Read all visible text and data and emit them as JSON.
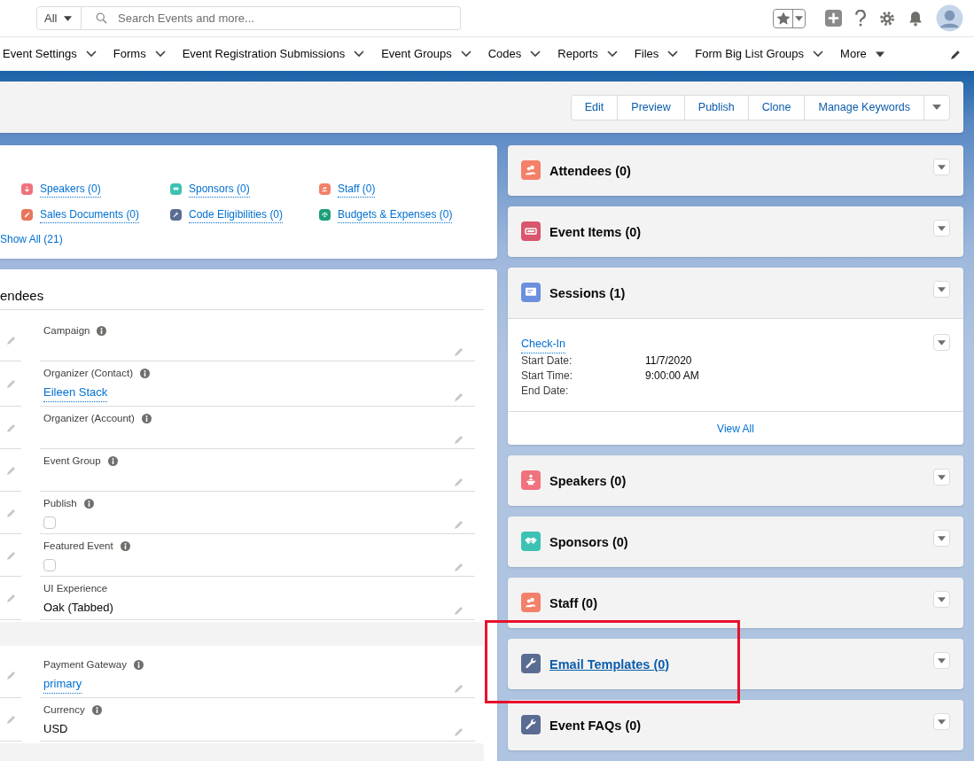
{
  "global_header": {
    "scope": "All",
    "search_placeholder": "Search Events and more..."
  },
  "nav": {
    "items": [
      {
        "label": "Event Settings",
        "kind": "menu"
      },
      {
        "label": "Forms",
        "kind": "menu"
      },
      {
        "label": "Event Registration Submissions",
        "kind": "menu"
      },
      {
        "label": "Event Groups",
        "kind": "menu"
      },
      {
        "label": "Codes",
        "kind": "menu"
      },
      {
        "label": "Reports",
        "kind": "menu"
      },
      {
        "label": "Files",
        "kind": "menu"
      },
      {
        "label": "Form Big List Groups",
        "kind": "menu"
      },
      {
        "label": "More",
        "kind": "more"
      }
    ]
  },
  "highlights": {
    "buttons": [
      "Edit",
      "Preview",
      "Publish",
      "Clone",
      "Manage Keywords"
    ]
  },
  "related_links": {
    "items": [
      {
        "label": "Speakers (0)",
        "kind": "podium",
        "color": "#f0727e"
      },
      {
        "label": "Sponsors (0)",
        "kind": "handshake",
        "color": "#3cc2b3"
      },
      {
        "label": "Staff (0)",
        "kind": "people",
        "color": "#f4806a"
      },
      {
        "label": "Sales Documents (0)",
        "kind": "pencil",
        "color": "#e9765a"
      },
      {
        "label": "Code Eligibilities (0)",
        "kind": "wrench",
        "color": "#5a6c92"
      },
      {
        "label": "Budgets & Expenses (0)",
        "kind": "scale",
        "color": "#1b9e7a"
      }
    ],
    "show_all": "Show All (21)"
  },
  "details": {
    "title": "endees",
    "blocks": [
      {
        "kind": "fields",
        "fields": [
          {
            "label": "Campaign",
            "info": true,
            "kind": "text"
          },
          {
            "label": "Organizer (Contact)",
            "info": true,
            "kind": "link",
            "value": "Eileen Stack"
          },
          {
            "label": "Organizer (Account)",
            "info": true,
            "kind": "text"
          },
          {
            "label": "Event Group",
            "info": true,
            "kind": "text"
          },
          {
            "label": "Publish",
            "info": true,
            "kind": "checkbox",
            "checked": false
          },
          {
            "label": "Featured Event",
            "info": true,
            "kind": "checkbox",
            "checked": false
          },
          {
            "label": "UI Experience",
            "info": false,
            "kind": "text",
            "value": "Oak (Tabbed)"
          }
        ]
      },
      {
        "kind": "section-bar"
      },
      {
        "kind": "fields",
        "fields": [
          {
            "label": "Payment Gateway",
            "info": true,
            "kind": "link",
            "value": "primary"
          },
          {
            "label": "Currency",
            "info": true,
            "kind": "text",
            "value": "USD"
          }
        ]
      },
      {
        "kind": "section-bar"
      }
    ]
  },
  "related_lists": [
    {
      "title": "Attendees (0)",
      "kind": "people",
      "color": "#f4806a",
      "hovered": false
    },
    {
      "title": "Event Items (0)",
      "kind": "ticket",
      "color": "#d9566d",
      "hovered": false
    },
    {
      "title": "Sessions (1)",
      "kind": "screen",
      "color": "#6b8fde",
      "hovered": false,
      "records": [
        {
          "name": "Check-In",
          "fields": [
            {
              "label": "Start Date:",
              "value": "11/7/2020"
            },
            {
              "label": "Start Time:",
              "value": "9:00:00 AM"
            },
            {
              "label": "End Date:"
            }
          ]
        }
      ],
      "footer": "View All"
    },
    {
      "title": "Speakers (0)",
      "kind": "podium",
      "color": "#f0727e",
      "hovered": false
    },
    {
      "title": "Sponsors (0)",
      "kind": "handshake",
      "color": "#3cc2b3",
      "hovered": false
    },
    {
      "title": "Staff (0)",
      "kind": "people",
      "color": "#f4806a",
      "hovered": false
    },
    {
      "title": "Email Templates (0)",
      "kind": "wrench",
      "color": "#5a6c92",
      "hovered": true
    },
    {
      "title": "Event FAQs (0)",
      "kind": "wrench",
      "color": "#5a6c92",
      "hovered": false
    }
  ]
}
